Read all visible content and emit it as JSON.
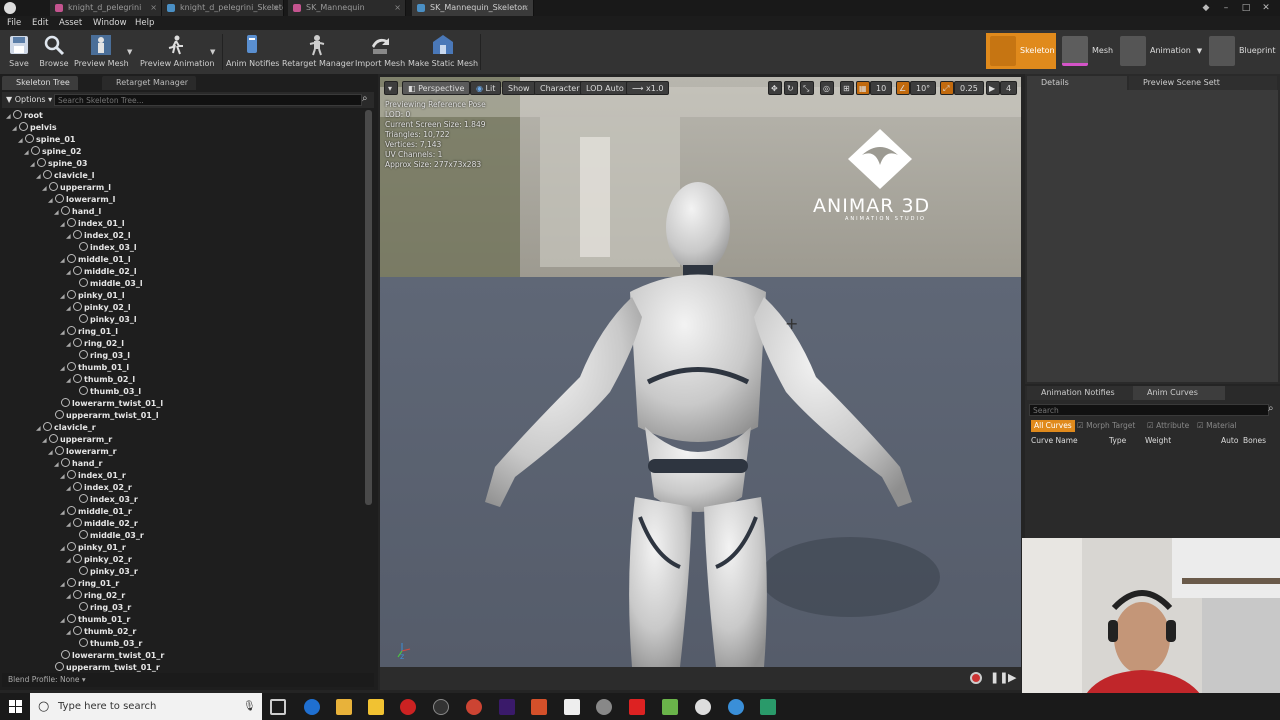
{
  "window": {
    "tabs": [
      {
        "label": "knight_d_pelegrini",
        "active": false
      },
      {
        "label": "knight_d_pelegrini_Skeleto",
        "active": false
      },
      {
        "label": "SK_Mannequin",
        "active": false
      },
      {
        "label": "SK_Mannequin_Skeleton",
        "active": true
      }
    ]
  },
  "menubar": {
    "file": "File",
    "edit": "Edit",
    "asset": "Asset",
    "window": "Window",
    "help": "Help"
  },
  "toolbar": {
    "save": "Save",
    "browse": "Browse",
    "preview_mesh": "Preview Mesh",
    "preview_animation": "Preview Animation",
    "anim_notifies": "Anim Notifies",
    "retarget_manager": "Retarget Manager",
    "import_mesh": "Import Mesh",
    "make_static_mesh": "Make Static Mesh"
  },
  "modes": {
    "skeleton": "Skeleton",
    "mesh": "Mesh",
    "animation": "Animation",
    "blueprint": "Blueprint"
  },
  "left_panel": {
    "tabs": [
      "Skeleton Tree",
      "Retarget Manager"
    ],
    "options_label": "Options",
    "search_placeholder": "Search Skeleton Tree...",
    "blend_profile": "Blend Profile: None"
  },
  "skeleton_tree": [
    {
      "name": "root",
      "depth": 0
    },
    {
      "name": "pelvis",
      "depth": 1
    },
    {
      "name": "spine_01",
      "depth": 2
    },
    {
      "name": "spine_02",
      "depth": 3
    },
    {
      "name": "spine_03",
      "depth": 4
    },
    {
      "name": "clavicle_l",
      "depth": 5
    },
    {
      "name": "upperarm_l",
      "depth": 6
    },
    {
      "name": "lowerarm_l",
      "depth": 7
    },
    {
      "name": "hand_l",
      "depth": 8
    },
    {
      "name": "index_01_l",
      "depth": 9
    },
    {
      "name": "index_02_l",
      "depth": 10
    },
    {
      "name": "index_03_l",
      "depth": 11
    },
    {
      "name": "middle_01_l",
      "depth": 9
    },
    {
      "name": "middle_02_l",
      "depth": 10
    },
    {
      "name": "middle_03_l",
      "depth": 11
    },
    {
      "name": "pinky_01_l",
      "depth": 9
    },
    {
      "name": "pinky_02_l",
      "depth": 10
    },
    {
      "name": "pinky_03_l",
      "depth": 11
    },
    {
      "name": "ring_01_l",
      "depth": 9
    },
    {
      "name": "ring_02_l",
      "depth": 10
    },
    {
      "name": "ring_03_l",
      "depth": 11
    },
    {
      "name": "thumb_01_l",
      "depth": 9
    },
    {
      "name": "thumb_02_l",
      "depth": 10
    },
    {
      "name": "thumb_03_l",
      "depth": 11
    },
    {
      "name": "lowerarm_twist_01_l",
      "depth": 8
    },
    {
      "name": "upperarm_twist_01_l",
      "depth": 7
    },
    {
      "name": "clavicle_r",
      "depth": 5
    },
    {
      "name": "upperarm_r",
      "depth": 6
    },
    {
      "name": "lowerarm_r",
      "depth": 7
    },
    {
      "name": "hand_r",
      "depth": 8
    },
    {
      "name": "index_01_r",
      "depth": 9
    },
    {
      "name": "index_02_r",
      "depth": 10
    },
    {
      "name": "index_03_r",
      "depth": 11
    },
    {
      "name": "middle_01_r",
      "depth": 9
    },
    {
      "name": "middle_02_r",
      "depth": 10
    },
    {
      "name": "middle_03_r",
      "depth": 11
    },
    {
      "name": "pinky_01_r",
      "depth": 9
    },
    {
      "name": "pinky_02_r",
      "depth": 10
    },
    {
      "name": "pinky_03_r",
      "depth": 11
    },
    {
      "name": "ring_01_r",
      "depth": 9
    },
    {
      "name": "ring_02_r",
      "depth": 10
    },
    {
      "name": "ring_03_r",
      "depth": 11
    },
    {
      "name": "thumb_01_r",
      "depth": 9
    },
    {
      "name": "thumb_02_r",
      "depth": 10
    },
    {
      "name": "thumb_03_r",
      "depth": 11
    },
    {
      "name": "lowerarm_twist_01_r",
      "depth": 8
    },
    {
      "name": "upperarm_twist_01_r",
      "depth": 7
    }
  ],
  "viewport": {
    "perspective": "Perspective",
    "lit": "Lit",
    "show": "Show",
    "character": "Character",
    "lod": "LOD Auto",
    "speed": "x1.0",
    "grid_snap": "10",
    "rot_snap": "10°",
    "scale_snap": "0.25",
    "cam_speed": "4",
    "info": [
      "Previewing Reference Pose",
      "LOD: 0",
      "Current Screen Size: 1.849",
      "Triangles: 10,722",
      "Vertices: 7,143",
      "UV Channels: 1",
      "Approx Size: 277x73x283"
    ],
    "logo_title": "ANIMAR 3D",
    "logo_subtitle": "ANIMATION STUDIO"
  },
  "right_panel": {
    "details_tab": "Details",
    "preview_scene_tab": "Preview Scene Sett",
    "anim_notifies_tab": "Animation Notifies",
    "anim_curves_tab": "Anim Curves",
    "search_placeholder": "Search",
    "filters": [
      "All Curves",
      "Morph Target",
      "Attribute",
      "Material"
    ],
    "columns": [
      "Curve Name",
      "Type",
      "Weight",
      "Auto",
      "Bones"
    ]
  },
  "taskbar": {
    "search_placeholder": "Type here to search"
  },
  "colors": {
    "accent_orange": "#e08a1c",
    "bone_text": "#e6e6e6",
    "panel_bg": "#1e1e1e"
  }
}
